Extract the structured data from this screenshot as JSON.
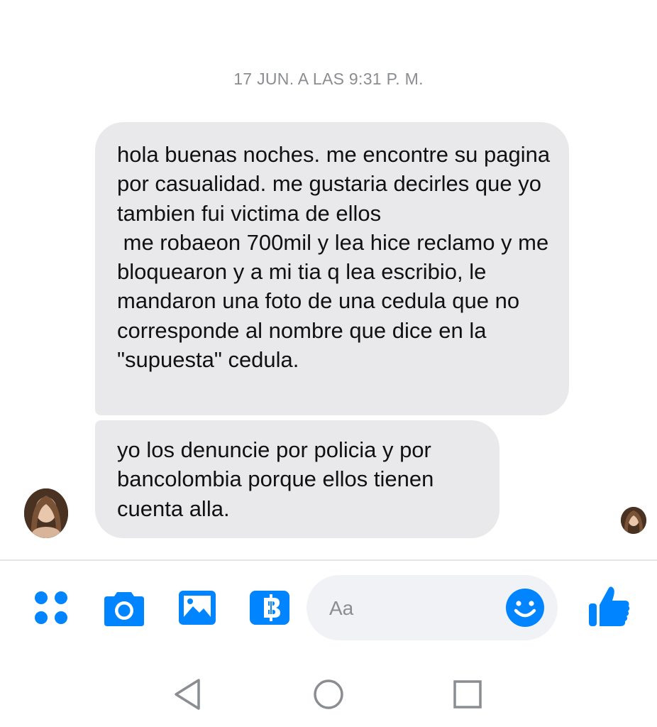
{
  "thread": {
    "timestamp": "17 JUN. A LAS 9:31 P. M.",
    "messages": [
      {
        "text": "hola buenas noches. me encontre su pagina por casualidad. me gustaria decirles que yo tambien fui victima de ellos\n me robaeon 700mil y lea hice reclamo y me bloquearon y a mi tia q lea escribio, le mandaron una foto de una cedula que no corresponde al nombre que dice en la \"supuesta\" cedula."
      },
      {
        "text": "yo los denuncie por policia y por bancolombia porque ellos tienen cuenta alla."
      }
    ]
  },
  "composer": {
    "placeholder": "Aa",
    "icons": [
      "menu-dots-icon",
      "camera-icon",
      "gallery-icon",
      "payment-icon",
      "emoji-icon",
      "thumbs-up-icon"
    ]
  },
  "system_nav": {
    "icons": [
      "back-icon",
      "home-icon",
      "recents-icon"
    ]
  },
  "colors": {
    "accent": "#0084ff",
    "bubble": "#e9e9eb",
    "timestamp": "#8a8d91"
  }
}
